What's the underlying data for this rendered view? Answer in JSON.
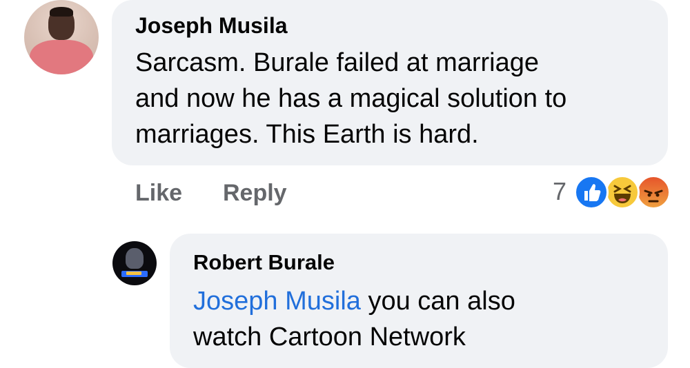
{
  "comments": [
    {
      "author": "Joseph Musila",
      "text_lines": [
        "Sarcasm. Burale failed at marriage",
        "and now he has a magical solution to",
        "marriages. This Earth is hard."
      ],
      "actions": {
        "like": "Like",
        "reply": "Reply"
      },
      "reactions": {
        "count": "7",
        "icons": [
          "like-icon",
          "haha-icon",
          "angry-icon"
        ]
      }
    },
    {
      "author": "Robert Burale",
      "mention": "Joseph Musila",
      "text_after_mention": " you can also",
      "text_line_2": "watch Cartoon Network"
    }
  ],
  "colors": {
    "bubble": "#f0f2f5",
    "mention": "#216fdb",
    "muted_text": "#65676b",
    "like_blue": "#1877f2",
    "haha_yellow": "#f7c93b",
    "angry_orange": "#e6552b"
  }
}
